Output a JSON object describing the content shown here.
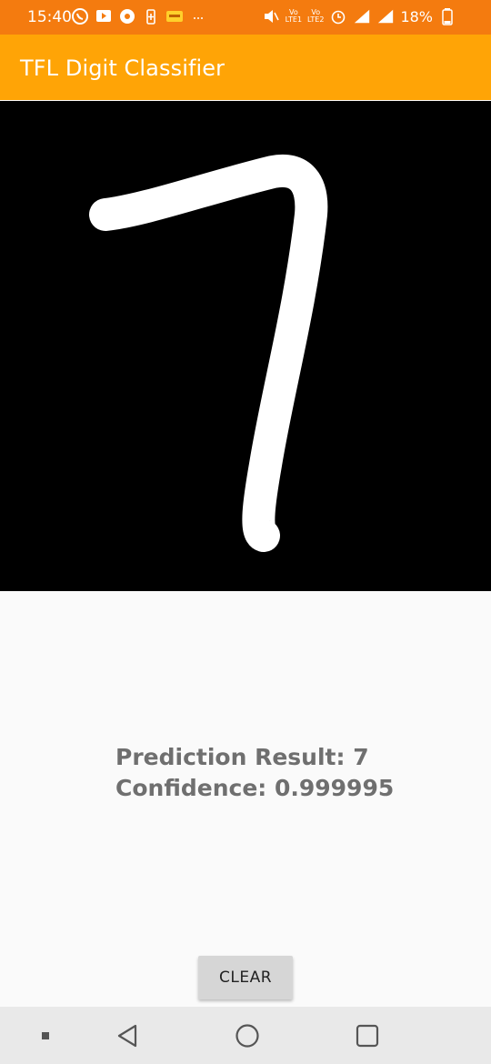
{
  "status_bar": {
    "time": "15:40",
    "battery_percent": "18%",
    "volte_1": {
      "top": "Vo",
      "bottom": "LTE1"
    },
    "volte_2": {
      "top": "Vo",
      "bottom": "LTE2"
    },
    "icons": [
      "whatsapp-icon",
      "video-app-icon",
      "settings-app-icon",
      "battery-saver-icon",
      "app-notification-icon",
      "more-notifications-icon",
      "mute-icon",
      "alarm-icon",
      "signal-sim1-icon",
      "signal-sim2-icon",
      "battery-icon"
    ],
    "background_color": "#f47b0f"
  },
  "app_bar": {
    "title": "TFL Digit Classifier",
    "background_color": "#ffa406"
  },
  "drawing_canvas": {
    "background_color": "#000000",
    "stroke_color": "#ffffff",
    "drawn_digit": "7"
  },
  "result": {
    "prediction_text": "Prediction Result: 7",
    "confidence_text": "Confidence: 0.999995"
  },
  "clear_button": {
    "label": "CLEAR"
  },
  "nav_bar": {
    "icons": [
      "menu-dot-icon",
      "back-icon",
      "home-icon",
      "recents-icon"
    ]
  }
}
